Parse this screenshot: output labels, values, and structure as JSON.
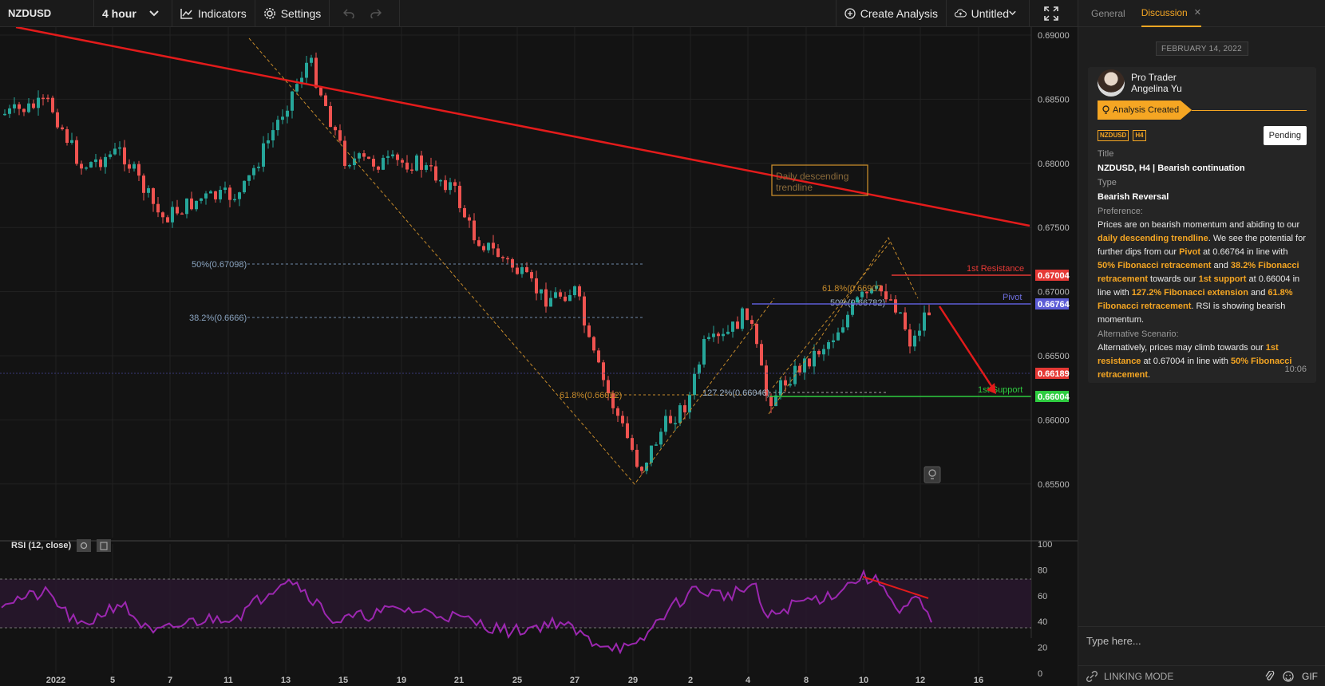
{
  "toolbar": {
    "symbol": "NZDUSD",
    "interval": "4 hour",
    "indicators": "Indicators",
    "settings": "Settings",
    "create_analysis": "Create Analysis",
    "layout_name": "Untitled"
  },
  "chart": {
    "price_ticks": [
      "0.69000",
      "0.68500",
      "0.68000",
      "0.67500",
      "0.67000",
      "0.66500",
      "0.66000",
      "0.65500"
    ],
    "rsi_ticks": [
      "100",
      "80",
      "60",
      "40",
      "20",
      "0"
    ],
    "date_ticks": [
      "2022",
      "5",
      "7",
      "11",
      "13",
      "15",
      "19",
      "21",
      "25",
      "27",
      "29",
      "2",
      "4",
      "8",
      "10",
      "12",
      "16"
    ],
    "resistance_label": "1st Resistance",
    "resistance_price": "0.67004",
    "pivot_label": "Pivot",
    "pivot_price": "0.66764",
    "current_price": "0.66189",
    "support_label": "1st Support",
    "support_price": "0.66004",
    "fib_50_left": "50%(0.67098)",
    "fib_382_left": "38.2%(0.6666)",
    "fib_618_left": "61.8%(0.66022)",
    "fib_1272": "127.2%(0.66046)",
    "fib_618_right": "61.8%(0.66907",
    "fib_50_right": "50%(0.66782)",
    "trendline_note_1": "Daily descending",
    "trendline_note_2": "trendline",
    "rsi_label": "RSI (12, close)",
    "colors": {
      "up": "#26a69a",
      "down": "#ef5350",
      "trendline": "#e31b1b",
      "resistance": "#e53935",
      "pivot": "#5c5cd6",
      "support": "#2ecc40",
      "fib": "#c58a2b",
      "rsi": "#9c27b0"
    }
  },
  "panel": {
    "tab_general": "General",
    "tab_discussion": "Discussion",
    "date": "FEBRUARY 14, 2022",
    "author_role": "Pro Trader",
    "author_name": "Angelina Yu",
    "status": "Analysis Created",
    "tag_symbol": "NZDUSD",
    "tag_tf": "H4",
    "pending": "Pending",
    "title_label": "Title",
    "title_value": "NZDUSD, H4 | Bearish continuation",
    "type_label": "Type",
    "type_value": "Bearish Reversal",
    "preference_label": "Preference:",
    "alt_label": "Alternative Scenario:",
    "time": "10:06",
    "composer_placeholder": "Type here...",
    "linking_mode": "LINKING MODE",
    "gif": "GIF"
  }
}
